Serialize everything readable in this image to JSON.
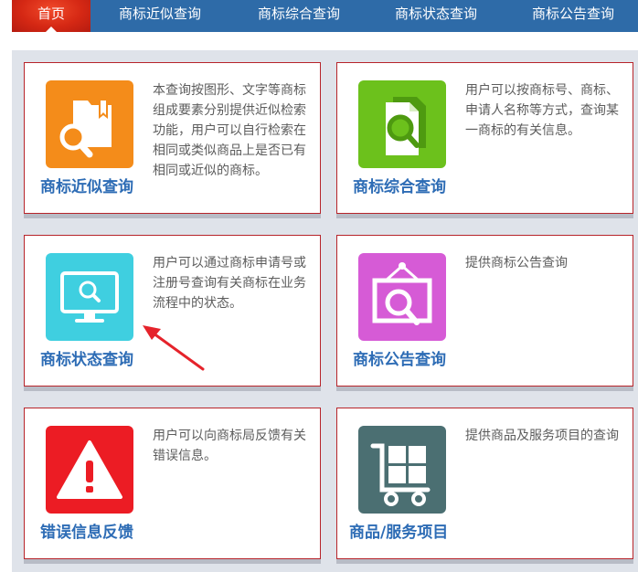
{
  "nav": {
    "items": [
      {
        "label": "首页",
        "active": true
      },
      {
        "label": "商标近似查询"
      },
      {
        "label": "商标综合查询"
      },
      {
        "label": "商标状态查询"
      },
      {
        "label": "商标公告查询"
      }
    ]
  },
  "cards": [
    {
      "title": "商标近似查询",
      "desc": "本查询按图形、文字等商标组成要素分别提供近似检索功能，用户可以自行检索在相同或类似商品上是否已有相同或近似的商标。",
      "icon": "folder-search-icon",
      "color": "#f48c1a"
    },
    {
      "title": "商标综合查询",
      "desc": "用户可以按商标号、商标、申请人名称等方式，查询某一商标的有关信息。",
      "icon": "documents-search-icon",
      "color": "#6cc11c"
    },
    {
      "title": "商标状态查询",
      "desc": "用户可以通过商标申请号或注册号查询有关商标在业务流程中的状态。",
      "icon": "monitor-search-icon",
      "color": "#3fcfe0"
    },
    {
      "title": "商标公告查询",
      "desc": "提供商标公告查询",
      "icon": "board-search-icon",
      "color": "#d65bd6"
    },
    {
      "title": "错误信息反馈",
      "desc": "用户可以向商标局反馈有关错误信息。",
      "icon": "warning-icon",
      "color": "#ec1c24"
    },
    {
      "title": "商品/服务项目",
      "desc": "提供商品及服务项目的查询",
      "icon": "cart-icon",
      "color": "#4b6f72"
    }
  ]
}
